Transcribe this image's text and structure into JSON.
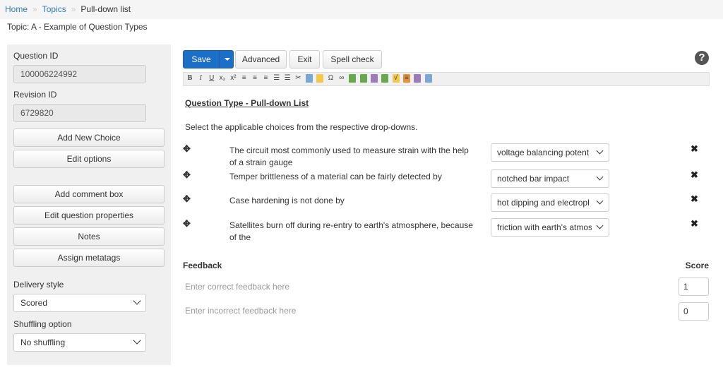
{
  "breadcrumb": {
    "home": "Home",
    "sep": "»",
    "topics": "Topics",
    "current": "Pull-down list"
  },
  "topic": "Topic: A - Example of Question Types",
  "left_panel": {
    "question_id_label": "Question ID",
    "question_id_value": "100006224992",
    "revision_id_label": "Revision ID",
    "revision_id_value": "6729820",
    "buttons_top": [
      "Add New Choice",
      "Edit options"
    ],
    "buttons_bottom": [
      "Add comment box",
      "Edit question properties",
      "Notes",
      "Assign metatags"
    ],
    "delivery_style_label": "Delivery style",
    "delivery_style_value": "Scored",
    "shuffling_label": "Shuffling option",
    "shuffling_value": "No shuffling"
  },
  "toolbar": {
    "save": "Save",
    "advanced": "Advanced",
    "exit": "Exit",
    "spell_check": "Spell check",
    "help": "?"
  },
  "editor_icons": [
    "B",
    "I",
    "U",
    "x₂",
    "x²",
    "≡",
    "≡",
    "≡",
    "☰",
    "☰",
    "✂",
    "❐",
    "📋",
    "Ω",
    "∞",
    "▦",
    "▦",
    "▦",
    "▦",
    "√",
    "≡",
    "▣",
    "▭"
  ],
  "question": {
    "title": "Question Type - Pull-down List",
    "instruction": "Select the applicable choices from the respective drop-downs.",
    "rows": [
      {
        "text": "The circuit most commonly used to measure strain with the help of a strain gauge",
        "answer": "voltage balancing potent"
      },
      {
        "text": "Temper brittleness of a material can be fairly detected by",
        "answer": "notched bar impact"
      },
      {
        "text": "Case hardening is not done by",
        "answer": "hot dipping and electropl"
      },
      {
        "text": "Satellites burn off during re-entry to earth's atmosphere, because of the",
        "answer": "friction with earth's atmos"
      }
    ]
  },
  "feedback": {
    "label": "Feedback",
    "score_label": "Score",
    "correct_placeholder": "Enter correct feedback here",
    "correct_score": "1",
    "incorrect_placeholder": "Enter incorrect feedback here",
    "incorrect_score": "0"
  }
}
